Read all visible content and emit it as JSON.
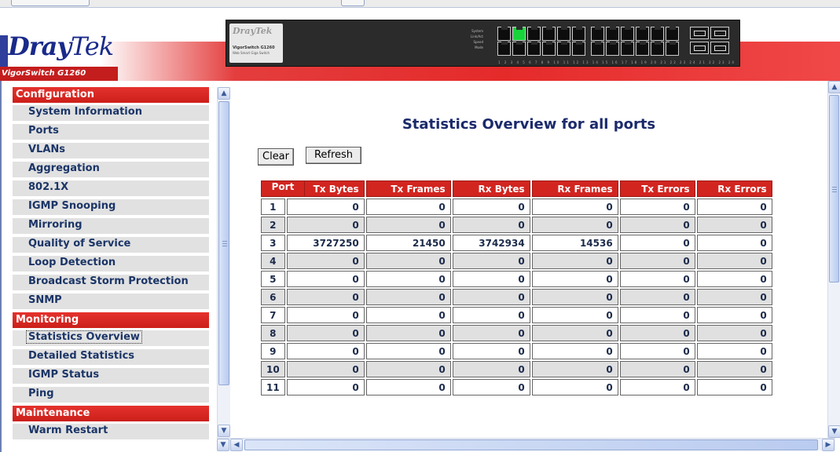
{
  "brand": {
    "logo_bold": "Dray",
    "logo_light": "Tek",
    "model": "VigorSwitch G1260"
  },
  "device_panel": {
    "brand": "DrayTek",
    "model": "VigorSwitch G1260",
    "description": "Web Smart Giga Switch",
    "led_labels": [
      "System",
      "Link/Act",
      "Speed",
      "Mode"
    ],
    "port_numbers": "1 2 3 4 5 6 7 8 9 10 11 12 13 14 15 16 17 18 19 20 21 22 23 24 21 22 23 24"
  },
  "sidebar": {
    "sections": [
      {
        "label": "Configuration",
        "items": [
          "System Information",
          "Ports",
          "VLANs",
          "Aggregation",
          "802.1X",
          "IGMP Snooping",
          "Mirroring",
          "Quality of Service",
          "Loop Detection",
          "Broadcast Storm Protection",
          "SNMP"
        ]
      },
      {
        "label": "Monitoring",
        "items": [
          "Statistics Overview",
          "Detailed Statistics",
          "IGMP Status",
          "Ping"
        ]
      },
      {
        "label": "Maintenance",
        "items": [
          "Warm Restart"
        ]
      }
    ],
    "selected": "Statistics Overview"
  },
  "main": {
    "title": "Statistics Overview for all ports",
    "buttons": {
      "clear": "Clear",
      "refresh": "Refresh"
    },
    "table": {
      "headers": [
        "Port",
        "Tx Bytes",
        "Tx Frames",
        "Rx Bytes",
        "Rx Frames",
        "Tx Errors",
        "Rx Errors"
      ],
      "rows": [
        [
          "1",
          "0",
          "0",
          "0",
          "0",
          "0",
          "0"
        ],
        [
          "2",
          "0",
          "0",
          "0",
          "0",
          "0",
          "0"
        ],
        [
          "3",
          "3727250",
          "21450",
          "3742934",
          "14536",
          "0",
          "0"
        ],
        [
          "4",
          "0",
          "0",
          "0",
          "0",
          "0",
          "0"
        ],
        [
          "5",
          "0",
          "0",
          "0",
          "0",
          "0",
          "0"
        ],
        [
          "6",
          "0",
          "0",
          "0",
          "0",
          "0",
          "0"
        ],
        [
          "7",
          "0",
          "0",
          "0",
          "0",
          "0",
          "0"
        ],
        [
          "8",
          "0",
          "0",
          "0",
          "0",
          "0",
          "0"
        ],
        [
          "9",
          "0",
          "0",
          "0",
          "0",
          "0",
          "0"
        ],
        [
          "10",
          "0",
          "0",
          "0",
          "0",
          "0",
          "0"
        ],
        [
          "11",
          "0",
          "0",
          "0",
          "0",
          "0",
          "0"
        ]
      ]
    }
  },
  "colors": {
    "accent_red": "#d22520",
    "brand_blue": "#1b2a6b",
    "link_port_green": "#17d43b"
  },
  "icons": {
    "scroll_up": "scroll-up-arrow-icon",
    "scroll_down": "scroll-down-arrow-icon",
    "scroll_left": "scroll-left-arrow-icon",
    "scroll_right": "scroll-right-arrow-icon"
  }
}
